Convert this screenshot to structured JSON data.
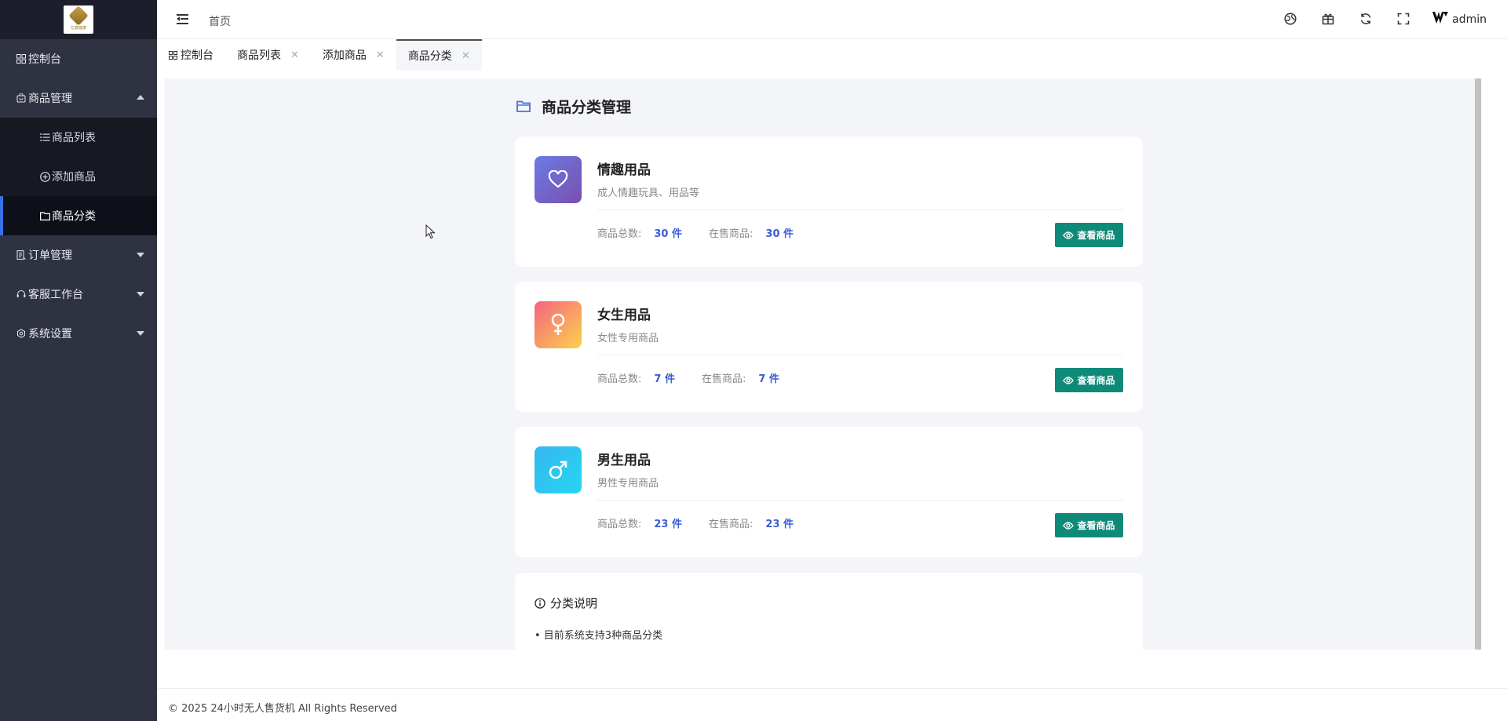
{
  "sidebar": {
    "logo_text": "亿鑫健康",
    "items": [
      {
        "label": "控制台",
        "icon": "dashboard-icon"
      },
      {
        "label": "商品管理",
        "icon": "shop-bag-icon",
        "expanded": true,
        "children": [
          {
            "label": "商品列表",
            "icon": "list-icon"
          },
          {
            "label": "添加商品",
            "icon": "add-circle-icon"
          },
          {
            "label": "商品分类",
            "icon": "folder-icon",
            "active": true
          }
        ]
      },
      {
        "label": "订单管理",
        "icon": "order-icon"
      },
      {
        "label": "客服工作台",
        "icon": "headset-icon"
      },
      {
        "label": "系统设置",
        "icon": "settings-icon"
      }
    ]
  },
  "header": {
    "breadcrumb": "首页",
    "user": "admin"
  },
  "tabs": [
    {
      "label": "控制台",
      "closable": false
    },
    {
      "label": "商品列表",
      "closable": true
    },
    {
      "label": "添加商品",
      "closable": true
    },
    {
      "label": "商品分类",
      "closable": true,
      "active": true
    }
  ],
  "main": {
    "title": "商品分类管理",
    "stat_total_label": "商品总数:",
    "stat_sale_label": "在售商品:",
    "view_button": "查看商品",
    "categories": [
      {
        "name": "情趣用品",
        "desc": "成人情趣玩具、用品等",
        "total": "30 件",
        "on_sale": "30 件",
        "icon": "heart-icon",
        "gradient": [
          "#6a7be3",
          "#7b4fb0"
        ]
      },
      {
        "name": "女生用品",
        "desc": "女性专用商品",
        "total": "7 件",
        "on_sale": "7 件",
        "icon": "female-icon",
        "gradient": [
          "#f5647e",
          "#fbd24c"
        ]
      },
      {
        "name": "男生用品",
        "desc": "男性专用商品",
        "total": "23 件",
        "on_sale": "23 件",
        "icon": "male-icon",
        "gradient": [
          "#35b6f0",
          "#26d6f2"
        ]
      }
    ],
    "note": {
      "title": "分类说明",
      "line1": "• 目前系统支持3种商品分类"
    }
  },
  "footer": "© 2025 24小时无人售货机 All Rights Reserved",
  "colors": {
    "sidebar_bg": "#2f3341",
    "accent": "#3a6fe8",
    "button_green": "#0e8a78",
    "value_blue": "#3a5ed8"
  }
}
